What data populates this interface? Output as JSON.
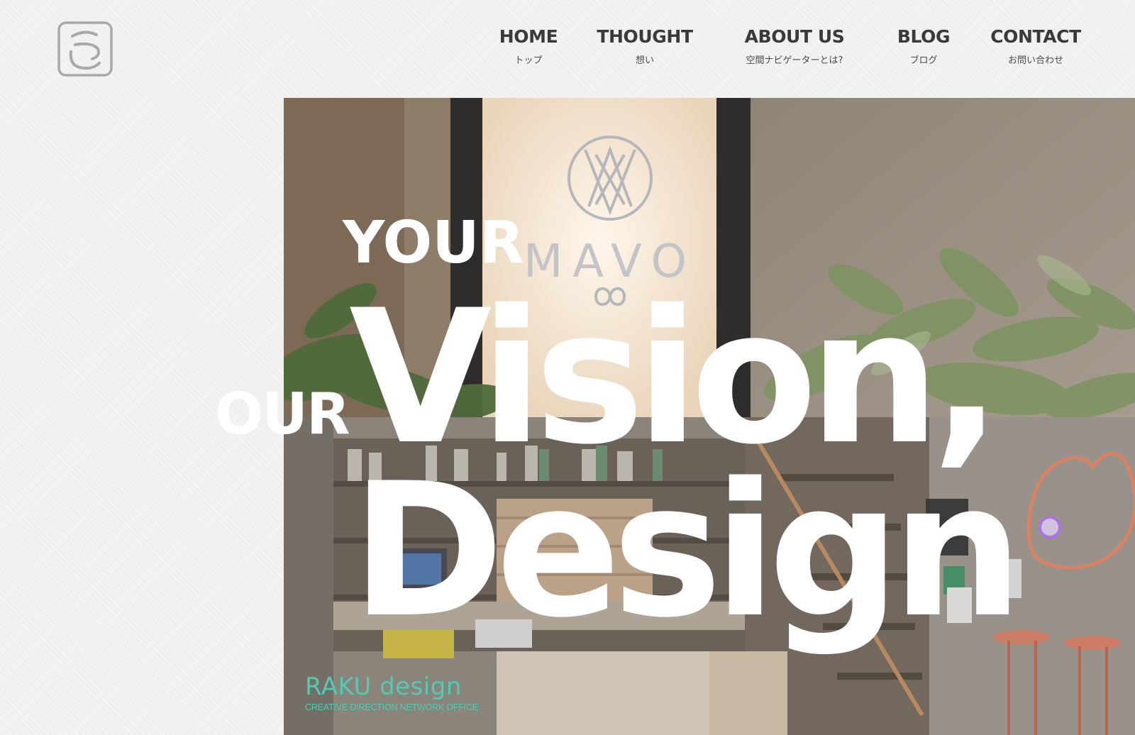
{
  "nav": {
    "items": [
      {
        "en": "HOME",
        "ja": "トップ"
      },
      {
        "en": "THOUGHT",
        "ja": "想い"
      },
      {
        "en": "ABOUT US",
        "ja": "空間ナビゲーターとは?"
      },
      {
        "en": "BLOG",
        "ja": "ブログ"
      },
      {
        "en": "CONTACT",
        "ja": "お問い合わせ"
      }
    ]
  },
  "hero": {
    "line_your": "YOUR",
    "line_our": "OUR",
    "line_vision": "Vision,",
    "line_design": "Design",
    "sign_text": "MAVO",
    "brand_name": "RAKU design",
    "brand_tagline": "CREATIVE DIRECTION  NETWORK OFFICE"
  },
  "icons": {
    "logo": "raku-logo-icon",
    "sign": "mavo-sign-emblem"
  },
  "colors": {
    "background": "#f1f1f1",
    "nav_text": "#3a3a3a",
    "headline": "#ffffff",
    "brand_accent": "#55c9b3"
  }
}
